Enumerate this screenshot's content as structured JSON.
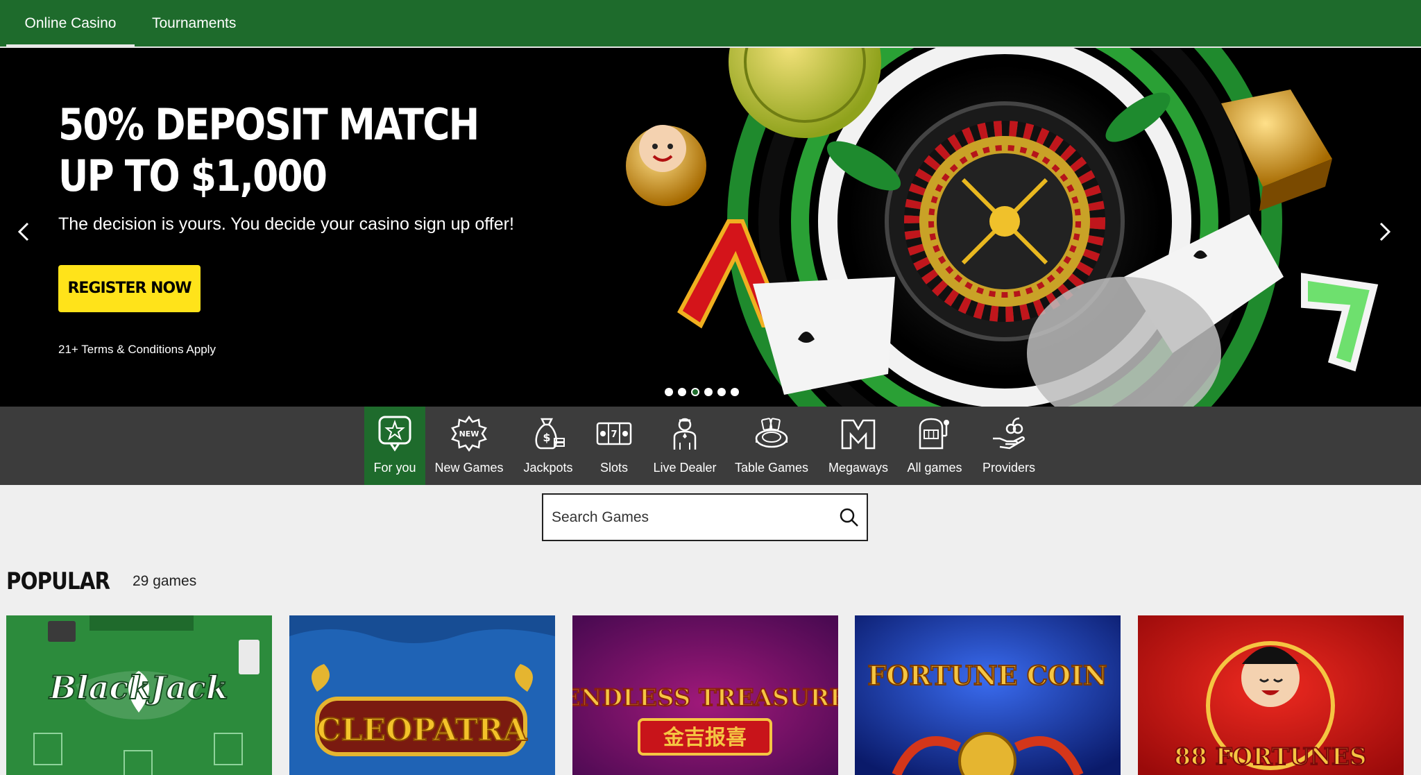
{
  "top_nav": {
    "tabs": [
      {
        "label": "Online Casino",
        "active": true
      },
      {
        "label": "Tournaments",
        "active": false
      }
    ]
  },
  "hero": {
    "title": "50% DEPOSIT MATCH UP TO $1,000",
    "subtitle": "The decision is yours. You decide your casino sign up offer!",
    "cta_label": "REGISTER NOW",
    "terms": "21+ Terms & Conditions Apply",
    "slide_count": 6,
    "active_slide": 3
  },
  "categories": [
    {
      "label": "For you",
      "icon": "star-bubble-icon",
      "active": true
    },
    {
      "label": "New Games",
      "icon": "new-badge-icon",
      "active": false
    },
    {
      "label": "Jackpots",
      "icon": "money-bag-icon",
      "active": false
    },
    {
      "label": "Slots",
      "icon": "slot-reels-icon",
      "active": false
    },
    {
      "label": "Live Dealer",
      "icon": "dealer-icon",
      "active": false
    },
    {
      "label": "Table Games",
      "icon": "roulette-table-icon",
      "active": false
    },
    {
      "label": "Megaways",
      "icon": "megaways-icon",
      "active": false
    },
    {
      "label": "All games",
      "icon": "slot-machine-icon",
      "active": false
    },
    {
      "label": "Providers",
      "icon": "providers-hand-icon",
      "active": false
    }
  ],
  "search": {
    "placeholder": "Search Games"
  },
  "popular": {
    "title": "POPULAR",
    "count": "29 games",
    "games": [
      {
        "name": "BlackJack"
      },
      {
        "name": "CLEOPATRA"
      },
      {
        "name": "ENDLESS TREASURE"
      },
      {
        "name": "FORTUNE COIN"
      },
      {
        "name": "88 FORTUNES"
      }
    ]
  },
  "colors": {
    "brand_green": "#1e6b2c",
    "cta_yellow": "#ffe31a",
    "category_bar": "#3c3c3c",
    "page_bg": "#efefef"
  }
}
